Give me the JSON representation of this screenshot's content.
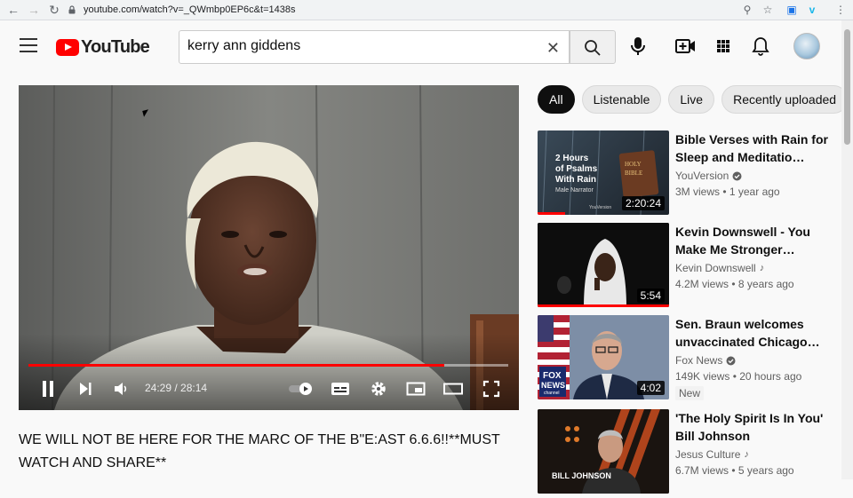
{
  "browser": {
    "url": "youtube.com/watch?v=_QWmbp0EP6c&t=1438s"
  },
  "header": {
    "logo_text": "YouTube",
    "search_value": "kerry ann giddens"
  },
  "player": {
    "current_time": "24:29",
    "duration": "28:14",
    "time_display": "24:29 / 28:14",
    "progress_fraction": 0.867
  },
  "video": {
    "title": "WE WILL NOT BE HERE FOR THE MARC OF THE B\"E:AST 6.6.6!!**MUST WATCH AND SHARE**"
  },
  "chips": [
    "All",
    "Listenable",
    "Live",
    "Recently uploaded"
  ],
  "recommendations": [
    {
      "title": "Bible Verses with Rain for Sleep and Meditatio…",
      "channel": "YouVersion",
      "channel_badge": "verified",
      "meta": "3M views • 1 year ago",
      "duration": "2:20:24",
      "watched_fraction": 0.21,
      "thumb_text": {
        "l1": "2 Hours",
        "l2": "of Psalms",
        "l3": "With Rain",
        "l4": "Male Narrator",
        "book1": "HOLY",
        "book2": "BIBLE",
        "brand": "YouVersion"
      }
    },
    {
      "title": "Kevin Downswell - You Make Me Stronger…",
      "channel": "Kevin Downswell",
      "channel_badge": "music",
      "meta": "4.2M views • 8 years ago",
      "duration": "5:54",
      "watched_fraction": 1.0
    },
    {
      "title": "Sen. Braun welcomes unvaccinated Chicago…",
      "channel": "Fox News",
      "channel_badge": "verified",
      "meta": "149K views • 20 hours ago",
      "badge": "New",
      "duration": "4:02",
      "watched_fraction": 0,
      "thumb_text": {
        "fox1": "FOX",
        "fox2": "NEWS",
        "fox3": "channel"
      }
    },
    {
      "title": "'The Holy Spirit Is In You' Bill Johnson",
      "channel": "Jesus Culture",
      "channel_badge": "music",
      "meta": "6.7M views • 5 years ago",
      "duration": "",
      "watched_fraction": 0,
      "thumb_text": {
        "name": "BILL JOHNSON"
      }
    }
  ],
  "colors": {
    "accent": "#ff0000",
    "chip_active": "#0f0f0f"
  }
}
